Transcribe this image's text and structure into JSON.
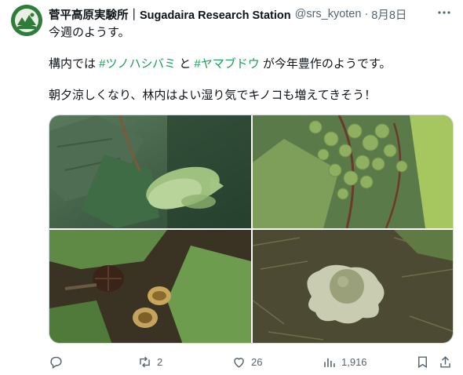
{
  "tweet": {
    "author_name": "菅平高原実験所｜Sugadaira Research Station",
    "handle": "@srs_kyoten",
    "separator": "·",
    "date": "8月8日",
    "more_label": "···",
    "line1": "今週のようす。",
    "line2_prefix": "構内では ",
    "hashtag1": "#ツノハシバミ",
    "line2_mid": " と ",
    "hashtag2": "#ヤマブドウ",
    "line2_suffix": " が今年豊作のようです。",
    "line3": "朝夕涼しくなり、林内はよい湿り気でキノコも増えてきそう！"
  },
  "images": [
    {
      "name": "hazelnut-photo",
      "subject": "ツノハシバミ"
    },
    {
      "name": "grape-photo",
      "subject": "ヤマブドウ"
    },
    {
      "name": "mushroom-photo",
      "subject": "キノコ"
    },
    {
      "name": "earthstar-photo",
      "subject": "キノコ"
    }
  ],
  "actions": {
    "reply_count": "",
    "retweet_count": "2",
    "like_count": "26",
    "view_count": "1,916"
  },
  "icons": [
    "reply-icon",
    "retweet-icon",
    "like-icon",
    "views-icon",
    "bookmark-icon",
    "share-icon",
    "more-icon"
  ],
  "colors": {
    "hashtag_blue": "#1d9bf0",
    "hashtag_green": "#1a9e5a",
    "secondary_text": "#536471"
  }
}
